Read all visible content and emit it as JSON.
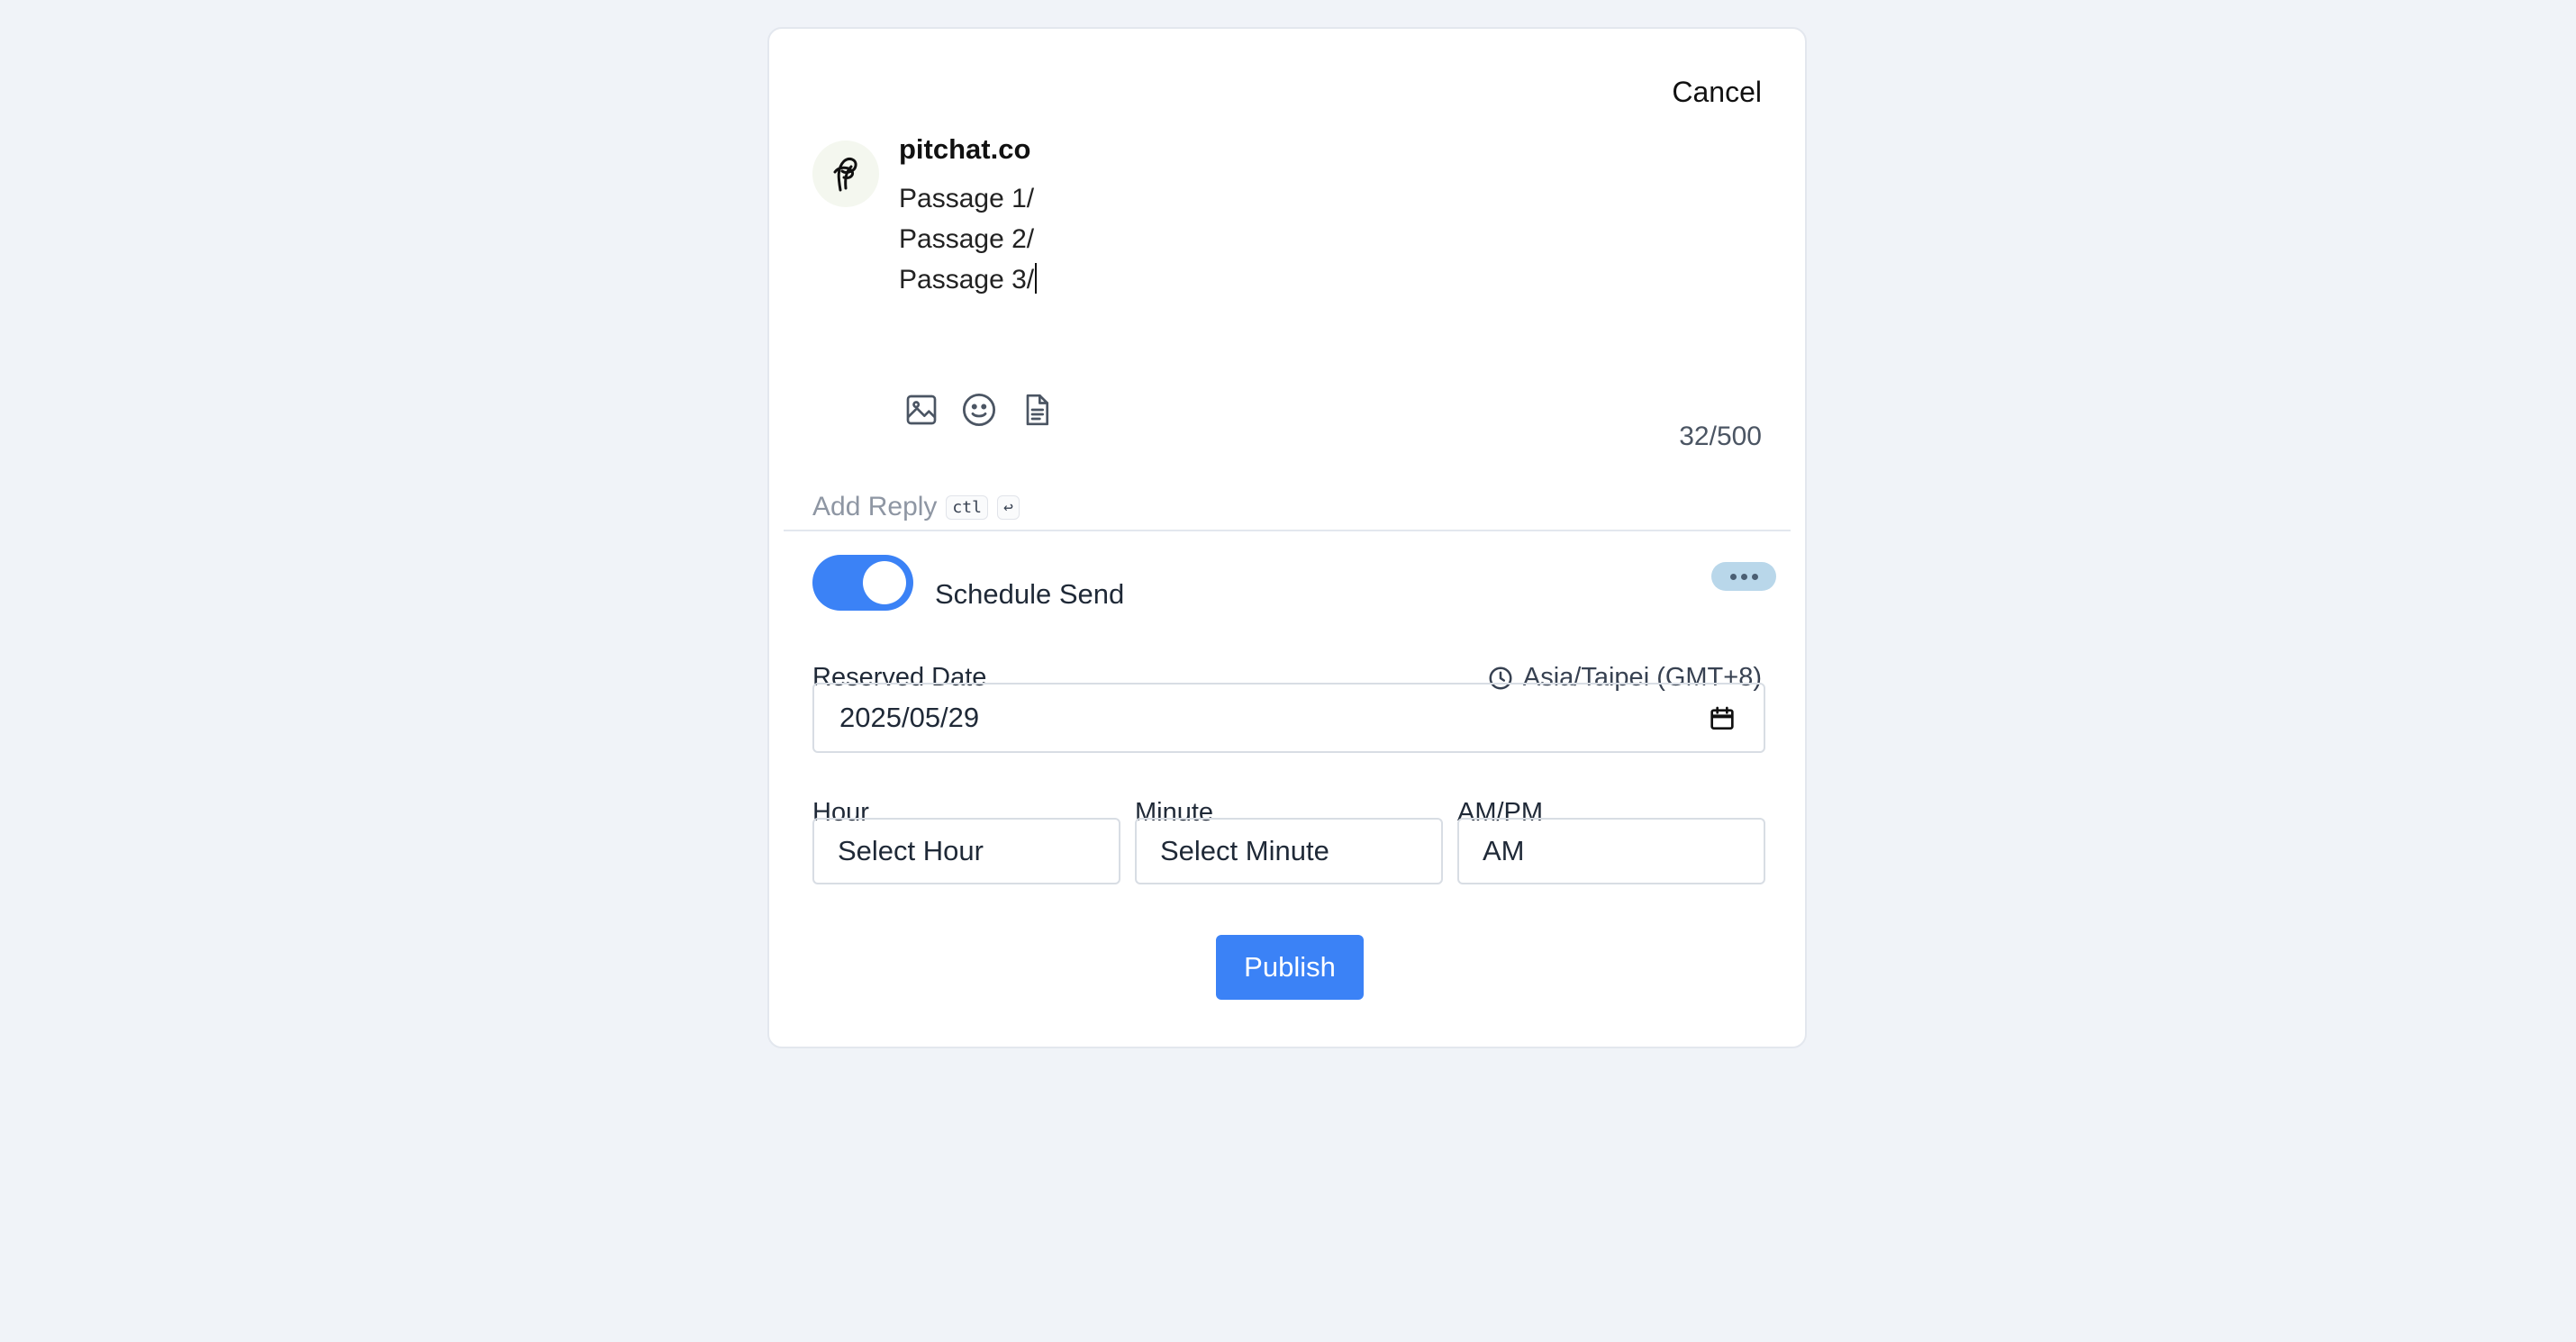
{
  "composer": {
    "cancel_label": "Cancel",
    "author": "pitchat.co",
    "lines": [
      "Passage 1/",
      "Passage 2/",
      "Passage 3/"
    ],
    "tool_icons": [
      "image-icon",
      "emoji-icon",
      "document-icon"
    ],
    "counter": "32/500",
    "add_reply_label": "Add Reply",
    "shortcut_ctl": "ctl",
    "shortcut_enter": "↩"
  },
  "schedule": {
    "toggle_on": true,
    "toggle_label": "Schedule Send",
    "reserved_date_label": "Reserved Date",
    "timezone": "Asia/Taipei (GMT+8)",
    "date_value": "2025/05/29",
    "hour_label": "Hour",
    "hour_value": "Select Hour",
    "minute_label": "Minute",
    "minute_value": "Select Minute",
    "ampm_label": "AM/PM",
    "ampm_value": "AM"
  },
  "actions": {
    "publish_label": "Publish"
  },
  "colors": {
    "accent": "#3b82f6",
    "background": "#f0f3f8",
    "more_button": "#b9d7ea"
  }
}
